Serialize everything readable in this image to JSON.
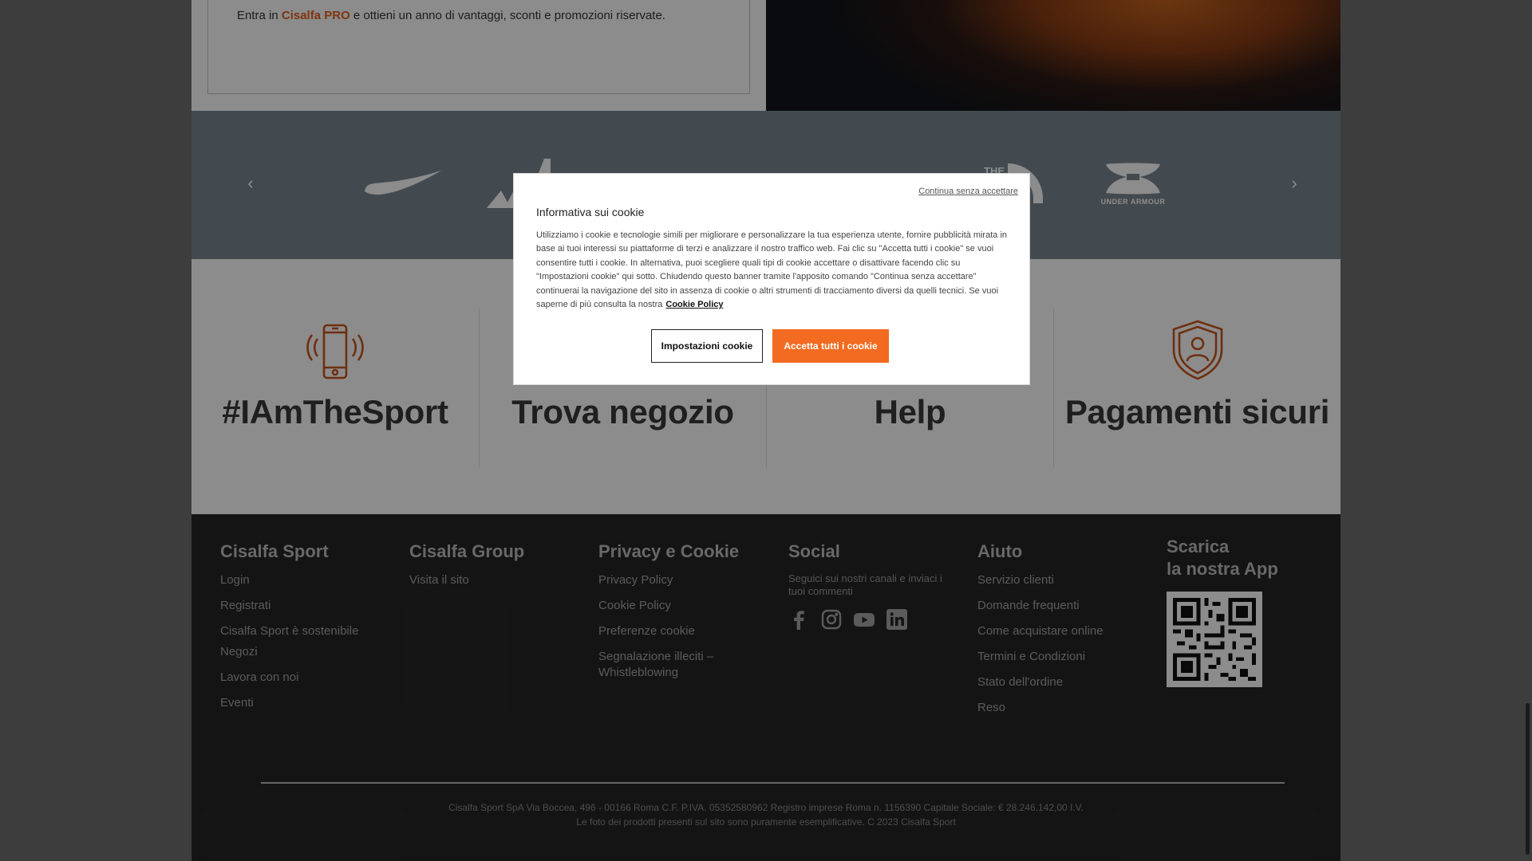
{
  "promo": {
    "text_before": "Entra in ",
    "brand": "Cisalfa PRO",
    "text_after": " e ottieni un anno di vantaggi, sconti e promozioni riservate."
  },
  "carousel": {
    "prev_icon": "‹",
    "next_icon": "›",
    "brands": [
      "nike-logo",
      "adidas-logo",
      "puma-logo",
      "new-balance-logo",
      "the-north-face-logo",
      "under-armour-logo"
    ],
    "under_armour_text": "UNDER ARMOUR"
  },
  "services": [
    {
      "label": "#IAmTheSport",
      "icon": "smartphone-icon"
    },
    {
      "label": "Trova negozio",
      "icon": "store-icon"
    },
    {
      "label": "Help",
      "icon": "help-icon"
    },
    {
      "label": "Pagamenti sicuri",
      "icon": "secure-shield-icon"
    }
  ],
  "footer": {
    "cisalfa_sport": {
      "title": "Cisalfa Sport",
      "links": [
        "Login",
        "Registrati",
        "Cisalfa Sport è sostenibile",
        "Negozi",
        "Lavora con noi",
        "Eventi"
      ]
    },
    "cisalfa_group": {
      "title": "Cisalfa Group",
      "links": [
        "Visita il sito"
      ]
    },
    "privacy": {
      "title": "Privacy e Cookie",
      "links": [
        "Privacy Policy",
        "Cookie Policy",
        "Preferenze cookie",
        "Segnalazione illeciti – Whistleblowing"
      ]
    },
    "social": {
      "title": "Social",
      "text": "Seguici sui nostri canali e inviaci i tuoi commenti",
      "icons": [
        "facebook-icon",
        "instagram-icon",
        "youtube-icon",
        "linkedin-icon"
      ]
    },
    "aiuto": {
      "title": "Aiuto",
      "links": [
        "Servizio clienti",
        "Domande frequenti",
        "Come acquistare online",
        "Termini e Condizioni",
        "Stato dell'ordine",
        "Reso"
      ]
    },
    "app": {
      "title_line1": "Scarica",
      "title_line2": "la nostra App"
    },
    "legal_line1": "Cisalfa Sport SpA Via Boccea, 496 - 00166 Roma C.F. P.IVA. 05352580962 Registro imprese Roma n. 1156390 Capitale Sociale: € 28.246.142,00 I.V.",
    "legal_line2": "Le foto dei prodotti presenti sul sito sono puramente esemplificative. C 2023 Cisalfa Sport"
  },
  "cookie_modal": {
    "continue_link": "Continua senza accettare",
    "title": "Informativa sui cookie",
    "body": "Utilizziamo i cookie e tecnologie simili per migliorare e personalizzare la tua esperienza utente, fornire pubblicità mirata in base ai tuoi interessi su piattaforme di terzi e analizzare il nostro traffico web. Fai clic su \"Accetta tutti i cookie\" se vuoi consentire tutti i cookie. In alternativa, puoi scegliere quali tipi di cookie accettare o disattivare facendo clic su \"Impostazioni cookie\" qui sotto. Chiudendo questo banner tramite l'apposito comando \"Continua senza accettare\" continuerai la navigazione del sito in assenza di cookie o altri strumenti di tracciamento diversi da quelli tecnici. Se vuoi saperne di più consulta la nostra",
    "policy_link": "Cookie Policy",
    "settings_button": "Impostazioni cookie",
    "accept_button": "Accetta tutti i cookie"
  },
  "colors": {
    "accent": "#f26b21",
    "brand_text": "#e8601c",
    "footer_bg": "#262626",
    "carousel_bg": "#7a8790"
  }
}
